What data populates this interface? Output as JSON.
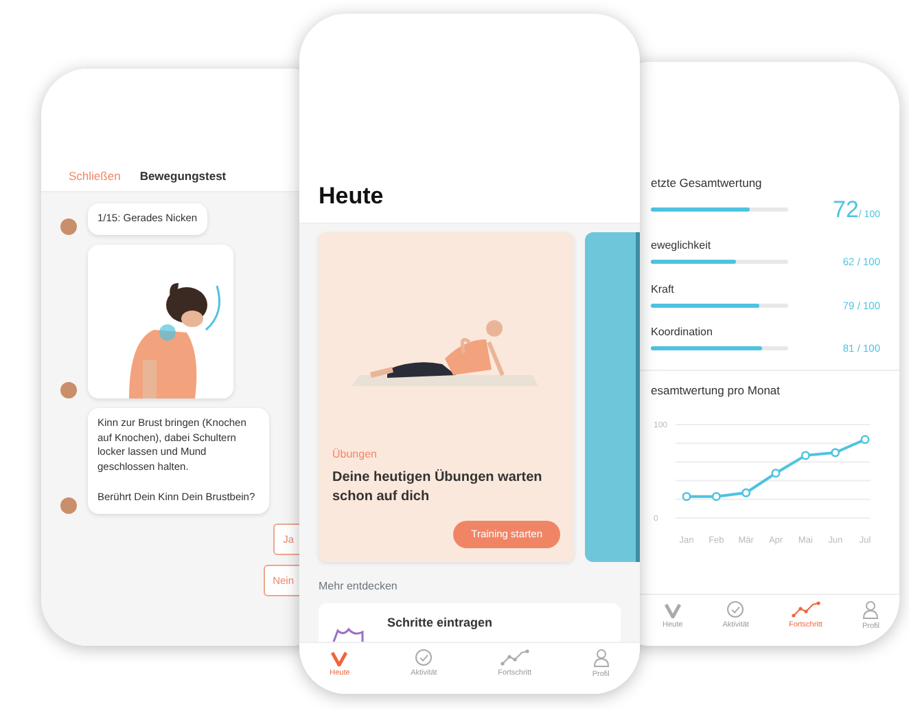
{
  "left_phone": {
    "header": {
      "close_link": "Schließen",
      "title": "Bewegungstest"
    },
    "messages": [
      {
        "kind": "text",
        "text": "1/15: Gerades Nicken"
      },
      {
        "kind": "picture"
      },
      {
        "kind": "text",
        "text": "Kinn zur Brust bringen (Knochen auf Knochen), dabei Schultern locker lassen und Mund geschlossen halten.\n\nBerührt Dein Kinn Dein Brustbein?"
      }
    ],
    "answers": [
      "Ja",
      "Nein"
    ]
  },
  "middle_phone": {
    "title": "Heute",
    "hero_card": {
      "kind": "picture",
      "category": "Übungen",
      "headline": "Deine heutigen Übungen warten schon auf dich",
      "button": "Training starten"
    },
    "section_label": "Mehr entdecken",
    "discover_card": {
      "title": "Schritte eintragen"
    },
    "tabs": [
      {
        "label": "Heute",
        "selected": true
      },
      {
        "label": "Aktivität",
        "selected": false
      },
      {
        "label": "Fortschritt",
        "selected": false
      },
      {
        "label": "Profil",
        "selected": false
      }
    ]
  },
  "right_phone": {
    "total": {
      "label": "etzte Gesamtwertung",
      "level": 0.72,
      "score": "72",
      "max": "/ 100"
    },
    "scores": [
      {
        "label": "eweglichkeit",
        "level": 0.62,
        "reading": "62 / 100"
      },
      {
        "label": "Kraft",
        "level": 0.79,
        "reading": "79 / 100"
      },
      {
        "label": "Koordination",
        "level": 0.81,
        "reading": "81 / 100"
      }
    ],
    "chart_title": "esamtwertung pro Monat",
    "chart_data": {
      "type": "line",
      "categories": [
        "Jan",
        "Feb",
        "Mär",
        "Apr",
        "Mai",
        "Jun",
        "Jul"
      ],
      "series": [
        {
          "marker": "circle",
          "color": "#4ec3e0",
          "values": [
            23,
            23,
            27,
            48,
            67,
            70,
            84
          ]
        }
      ],
      "ylim": [
        0,
        100
      ],
      "yticks": [
        0,
        100
      ]
    },
    "tabs": [
      {
        "label": "Heute",
        "selected": false
      },
      {
        "label": "Aktivität",
        "selected": false
      },
      {
        "label": "Fortschritt",
        "selected": true
      },
      {
        "label": "Profil",
        "selected": false
      }
    ]
  }
}
